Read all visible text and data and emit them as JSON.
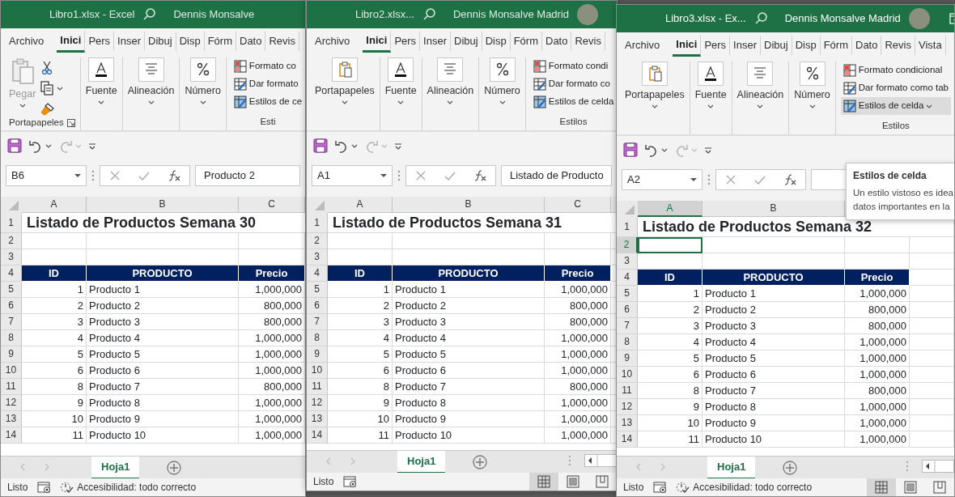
{
  "windows": [
    {
      "title": "Libro1.xlsx  -  Excel",
      "user": "Dennis Monsalve",
      "account_area": false,
      "active": false,
      "tabs": [
        {
          "label": "Archivo",
          "selected": false
        },
        {
          "label": "Inici",
          "selected": true
        },
        {
          "label": "Pers",
          "selected": false
        },
        {
          "label": "Inser",
          "selected": false
        },
        {
          "label": "Dibuj",
          "selected": false
        },
        {
          "label": "Disp",
          "selected": false
        },
        {
          "label": "Fórm",
          "selected": false
        },
        {
          "label": "Dato",
          "selected": false
        },
        {
          "label": "Revis",
          "selected": false
        }
      ],
      "clipboard": {
        "expanded": true,
        "label": "Portapapeles",
        "paste": "Pegar"
      },
      "groups": [
        "Fuente",
        "Alineación",
        "Número"
      ],
      "styles": {
        "items": [
          {
            "label": "Formato co",
            "hovered": false,
            "caret": false
          },
          {
            "label": "Dar formato",
            "hovered": false,
            "caret": false
          },
          {
            "label": "Estilos de ce",
            "hovered": false,
            "caret": false
          }
        ],
        "label": "Esti"
      },
      "name_box": "B6",
      "formula": "Producto 2",
      "columns": [
        "A",
        "B",
        "C"
      ],
      "rows": [
        {
          "number": "1",
          "kind": "title",
          "cells": [
            "Listado de Productos Semana 30"
          ]
        },
        {
          "number": "2",
          "kind": "blank",
          "cells": []
        },
        {
          "number": "3",
          "kind": "blank",
          "cells": []
        },
        {
          "number": "4",
          "kind": "header",
          "cells": [
            "ID",
            "PRODUCTO",
            "Precio"
          ]
        },
        {
          "number": "5",
          "kind": "data",
          "cells": [
            "1",
            "Producto 1",
            "1,000,000"
          ]
        },
        {
          "number": "6",
          "kind": "data",
          "cells": [
            "2",
            "Producto 2",
            "800,000"
          ]
        },
        {
          "number": "7",
          "kind": "data",
          "cells": [
            "3",
            "Producto 3",
            "800,000"
          ]
        },
        {
          "number": "8",
          "kind": "data",
          "cells": [
            "4",
            "Producto 4",
            "1,000,000"
          ]
        },
        {
          "number": "9",
          "kind": "data",
          "cells": [
            "5",
            "Producto 5",
            "1,000,000"
          ]
        },
        {
          "number": "10",
          "kind": "data",
          "cells": [
            "6",
            "Producto 6",
            "1,000,000"
          ]
        },
        {
          "number": "11",
          "kind": "data",
          "cells": [
            "8",
            "Producto 7",
            "800,000"
          ]
        },
        {
          "number": "12",
          "kind": "data",
          "cells": [
            "9",
            "Producto 8",
            "1,000,000"
          ]
        },
        {
          "number": "13",
          "kind": "data",
          "cells": [
            "10",
            "Producto 9",
            "1,000,000"
          ]
        },
        {
          "number": "14",
          "kind": "data",
          "cells": [
            "11",
            "Producto 10",
            "1,000,000"
          ]
        }
      ],
      "sheet_tabs": [
        {
          "label": "Hoja1",
          "selected": true
        }
      ],
      "scrollbar": false,
      "status": "Listo",
      "accessibility": "Accesibilidad: todo correcto"
    },
    {
      "title": "Libro2.xlsx...",
      "user": "Dennis Monsalve Madrid",
      "account_area": true,
      "active": false,
      "tabs": [
        {
          "label": "Archivo",
          "selected": false
        },
        {
          "label": "Inici",
          "selected": true
        },
        {
          "label": "Pers",
          "selected": false
        },
        {
          "label": "Inser",
          "selected": false
        },
        {
          "label": "Dibuj",
          "selected": false
        },
        {
          "label": "Disp",
          "selected": false
        },
        {
          "label": "Fórm",
          "selected": false
        },
        {
          "label": "Dato",
          "selected": false
        },
        {
          "label": "Revis",
          "selected": false
        }
      ],
      "clipboard": {
        "expanded": false,
        "label": "Portapapeles"
      },
      "groups": [
        "Fuente",
        "Alineación",
        "Número"
      ],
      "styles": {
        "items": [
          {
            "label": "Formato condi",
            "hovered": false,
            "caret": false
          },
          {
            "label": "Dar formato co",
            "hovered": false,
            "caret": false
          },
          {
            "label": "Estilos de celda",
            "hovered": false,
            "caret": false
          }
        ],
        "label": "Estilos"
      },
      "name_box": "A1",
      "formula": "Listado de Producto",
      "columns": [
        "A",
        "B",
        "C"
      ],
      "rows": [
        {
          "number": "1",
          "kind": "title",
          "cells": [
            "Listado de Productos Semana 31"
          ]
        },
        {
          "number": "2",
          "kind": "blank",
          "cells": []
        },
        {
          "number": "3",
          "kind": "blank",
          "cells": []
        },
        {
          "number": "4",
          "kind": "header",
          "cells": [
            "ID",
            "PRODUCTO",
            "Precio"
          ]
        },
        {
          "number": "5",
          "kind": "data",
          "cells": [
            "1",
            "Producto 1",
            "1,000,000"
          ]
        },
        {
          "number": "6",
          "kind": "data",
          "cells": [
            "2",
            "Producto 2",
            "800,000"
          ]
        },
        {
          "number": "7",
          "kind": "data",
          "cells": [
            "3",
            "Producto 3",
            "800,000"
          ]
        },
        {
          "number": "8",
          "kind": "data",
          "cells": [
            "4",
            "Producto 4",
            "1,000,000"
          ]
        },
        {
          "number": "9",
          "kind": "data",
          "cells": [
            "5",
            "Producto 5",
            "1,000,000"
          ]
        },
        {
          "number": "10",
          "kind": "data",
          "cells": [
            "6",
            "Producto 6",
            "1,000,000"
          ]
        },
        {
          "number": "11",
          "kind": "data",
          "cells": [
            "8",
            "Producto 7",
            "800,000"
          ]
        },
        {
          "number": "12",
          "kind": "data",
          "cells": [
            "9",
            "Producto 8",
            "1,000,000"
          ]
        },
        {
          "number": "13",
          "kind": "data",
          "cells": [
            "10",
            "Producto 9",
            "1,000,000"
          ]
        },
        {
          "number": "14",
          "kind": "data",
          "cells": [
            "11",
            "Producto 10",
            "1,000,000"
          ]
        }
      ],
      "sheet_tabs": [
        {
          "label": "Hoja1",
          "selected": true
        }
      ],
      "scrollbar": true,
      "status": "Listo",
      "view_buttons": [
        {
          "selected": true
        },
        {
          "selected": false
        },
        {
          "selected": false
        }
      ]
    },
    {
      "title": "Libro3.xlsx  -  Ex...",
      "user": "Dennis Monsalve Madrid",
      "account_area": true,
      "active": true,
      "tabs": [
        {
          "label": "Archivo",
          "selected": false
        },
        {
          "label": "Inici",
          "selected": true
        },
        {
          "label": "Pers",
          "selected": false
        },
        {
          "label": "Inser",
          "selected": false
        },
        {
          "label": "Dibuj",
          "selected": false
        },
        {
          "label": "Disp",
          "selected": false
        },
        {
          "label": "Fórm",
          "selected": false
        },
        {
          "label": "Dato",
          "selected": false
        },
        {
          "label": "Revis",
          "selected": false
        },
        {
          "label": "Vista",
          "selected": false
        }
      ],
      "clipboard": {
        "expanded": false,
        "label": "Portapapeles"
      },
      "groups": [
        "Fuente",
        "Alineación",
        "Número"
      ],
      "styles": {
        "items": [
          {
            "label": "Formato condicional",
            "hovered": false,
            "caret": false
          },
          {
            "label": "Dar formato como tab",
            "hovered": false,
            "caret": false
          },
          {
            "label": "Estilos de celda",
            "hovered": true,
            "caret": true
          }
        ],
        "label": "Estilos"
      },
      "name_box": "A2",
      "columns": [
        "A",
        "B",
        null
      ],
      "tooltip": {
        "title": "Estilos de celda",
        "lines": [
          "Un estilo vistoso es idea",
          "datos importantes en la"
        ]
      },
      "rows": [
        {
          "number": "1",
          "kind": "title",
          "cells": [
            "Listado de Productos Semana 32"
          ]
        },
        {
          "number": "2",
          "kind": "blank",
          "cells": []
        },
        {
          "number": "3",
          "kind": "blank",
          "cells": []
        },
        {
          "number": "4",
          "kind": "header",
          "cells": [
            "ID",
            "PRODUCTO",
            "Precio"
          ]
        },
        {
          "number": "5",
          "kind": "data",
          "cells": [
            "1",
            "Producto 1",
            "1,000,000"
          ]
        },
        {
          "number": "6",
          "kind": "data",
          "cells": [
            "2",
            "Producto 2",
            "800,000"
          ]
        },
        {
          "number": "7",
          "kind": "data",
          "cells": [
            "3",
            "Producto 3",
            "800,000"
          ]
        },
        {
          "number": "8",
          "kind": "data",
          "cells": [
            "4",
            "Producto 4",
            "1,000,000"
          ]
        },
        {
          "number": "9",
          "kind": "data",
          "cells": [
            "5",
            "Producto 5",
            "1,000,000"
          ]
        },
        {
          "number": "10",
          "kind": "data",
          "cells": [
            "6",
            "Producto 6",
            "1,000,000"
          ]
        },
        {
          "number": "11",
          "kind": "data",
          "cells": [
            "8",
            "Producto 7",
            "800,000"
          ]
        },
        {
          "number": "12",
          "kind": "data",
          "cells": [
            "9",
            "Producto 8",
            "1,000,000"
          ]
        },
        {
          "number": "13",
          "kind": "data",
          "cells": [
            "10",
            "Producto 9",
            "1,000,000"
          ]
        },
        {
          "number": "14",
          "kind": "data",
          "cells": [
            "11",
            "Producto 10",
            "1,000,000"
          ]
        }
      ],
      "sheet_tabs": [
        {
          "label": "Hoja1",
          "selected": true
        }
      ],
      "scrollbar": true,
      "status": "Listo",
      "accessibility": "Accesibilidad: todo correcto",
      "view_buttons": [
        {
          "selected": true
        },
        {
          "selected": false
        },
        {
          "selected": false
        }
      ]
    }
  ]
}
